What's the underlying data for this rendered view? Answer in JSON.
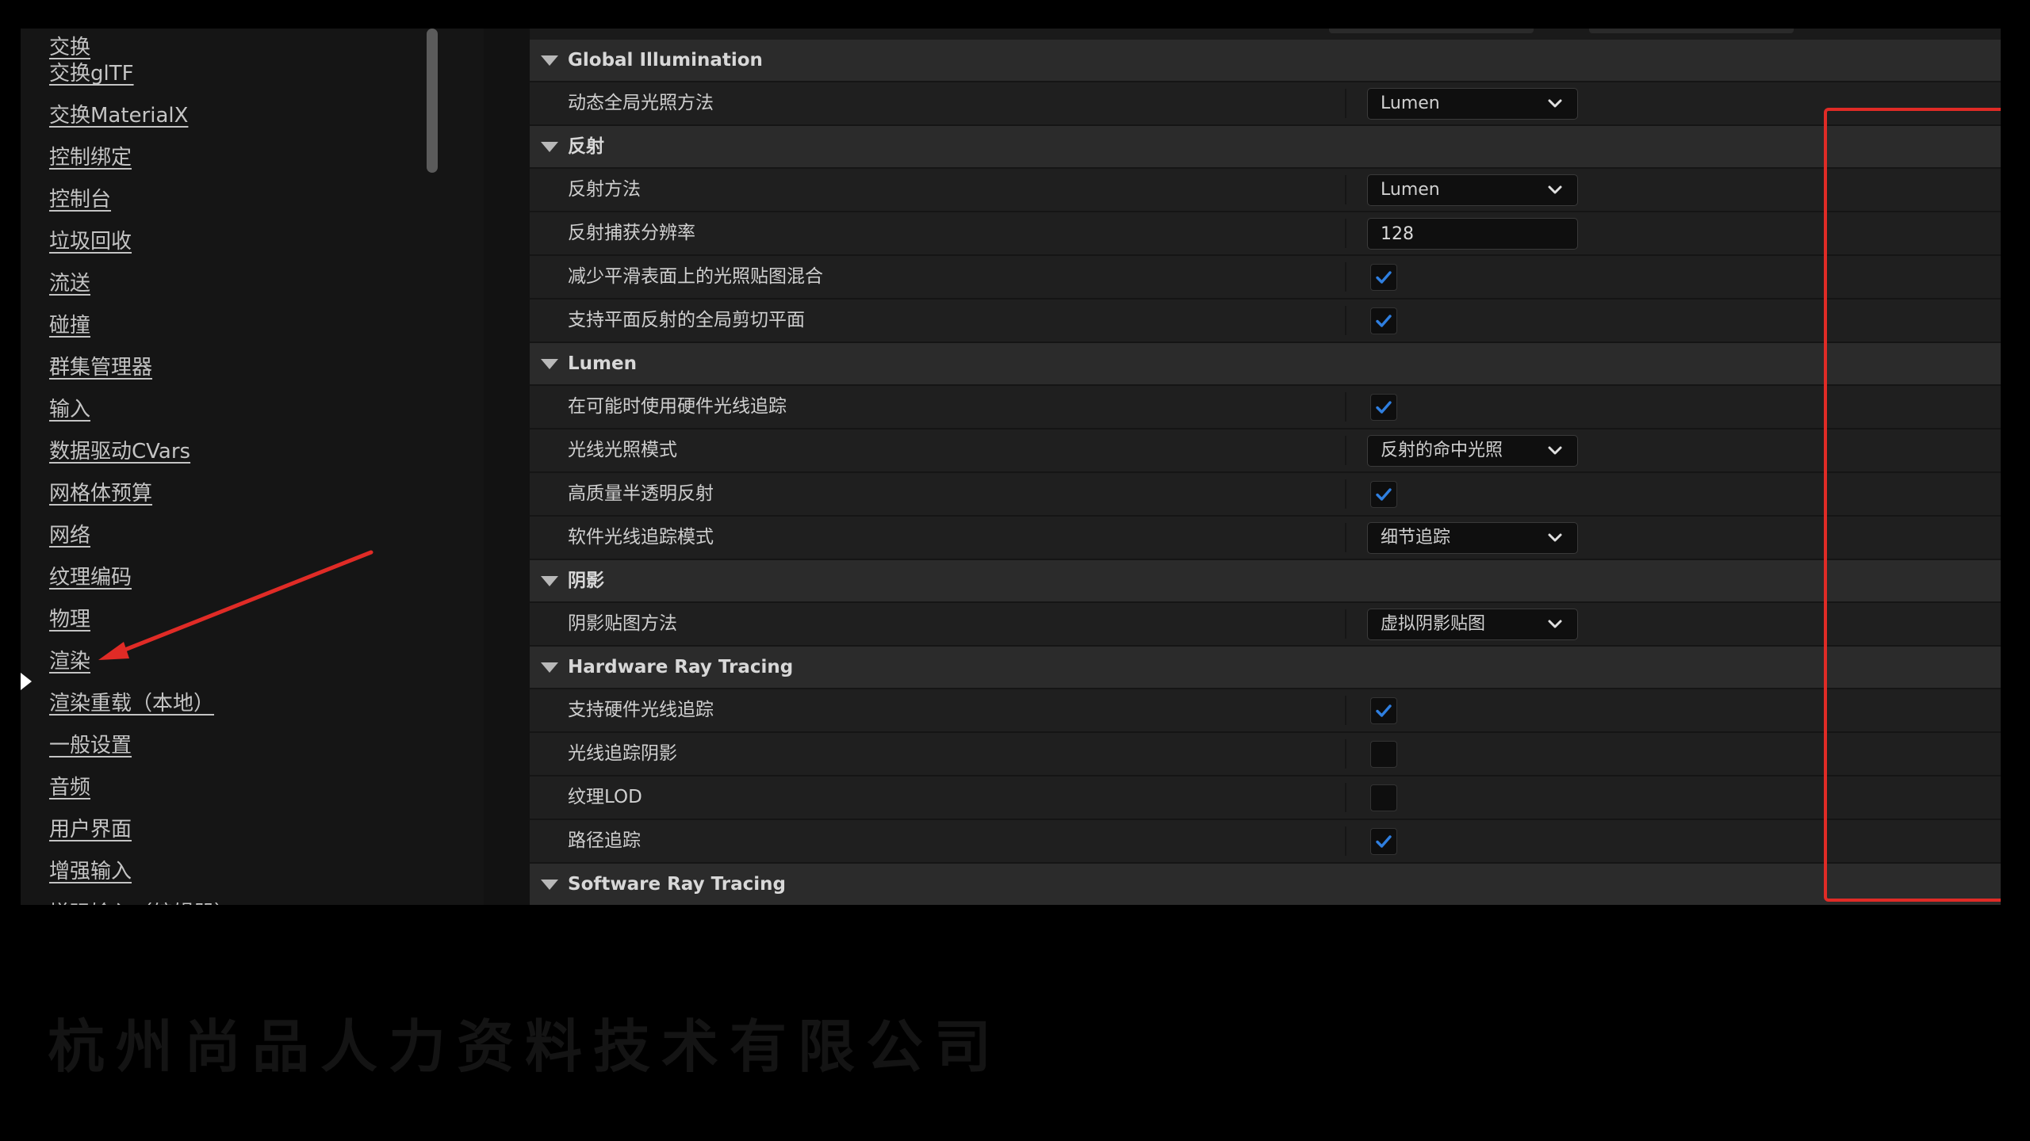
{
  "sidebar": {
    "items": [
      {
        "label": "交换"
      },
      {
        "label": "交换glTF"
      },
      {
        "label": "交换MaterialX"
      },
      {
        "label": "控制绑定"
      },
      {
        "label": "控制台"
      },
      {
        "label": "垃圾回收"
      },
      {
        "label": "流送"
      },
      {
        "label": "碰撞"
      },
      {
        "label": "群集管理器"
      },
      {
        "label": "输入"
      },
      {
        "label": "数据驱动CVars"
      },
      {
        "label": "网格体预算"
      },
      {
        "label": "网络"
      },
      {
        "label": "纹理编码"
      },
      {
        "label": "物理"
      },
      {
        "label": "渲染",
        "selected": true
      },
      {
        "label": "渲染重载（本地）"
      },
      {
        "label": "一般设置"
      },
      {
        "label": "音频"
      },
      {
        "label": "用户界面"
      },
      {
        "label": "增强输入"
      },
      {
        "label": "增强输入（编辑器）"
      }
    ]
  },
  "sections": {
    "gi": {
      "title": "Global Illumination",
      "dyn_gi_label": "动态全局光照方法",
      "dyn_gi_value": "Lumen"
    },
    "reflection": {
      "title": "反射",
      "method_label": "反射方法",
      "method_value": "Lumen",
      "capture_res_label": "反射捕获分辨率",
      "capture_res_value": "128",
      "reduce_lightmap_label": "减少平滑表面上的光照贴图混合",
      "reduce_lightmap_checked": true,
      "clip_plane_label": "支持平面反射的全局剪切平面",
      "clip_plane_checked": true
    },
    "lumen": {
      "title": "Lumen",
      "hw_rt_label": "在可能时使用硬件光线追踪",
      "hw_rt_checked": true,
      "lighting_mode_label": "光线光照模式",
      "lighting_mode_value": "反射的命中光照",
      "hq_translucency_label": "高质量半透明反射",
      "hq_translucency_checked": true,
      "sw_trace_mode_label": "软件光线追踪模式",
      "sw_trace_mode_value": "细节追踪"
    },
    "shadows": {
      "title": "阴影",
      "shadow_map_label": "阴影贴图方法",
      "shadow_map_value": "虚拟阴影贴图"
    },
    "hw_rt": {
      "title": "Hardware Ray Tracing",
      "support_label": "支持硬件光线追踪",
      "support_checked": true,
      "shadows_label": "光线追踪阴影",
      "shadows_checked": false,
      "texture_lod_label": "纹理LOD",
      "texture_lod_checked": false,
      "path_tracing_label": "路径追踪",
      "path_tracing_checked": true
    },
    "sw_rt": {
      "title": "Software Ray Tracing"
    }
  },
  "watermark": "杭州尚品人力资料技术有限公司",
  "colors": {
    "check_blue": "#2f7fe0",
    "highlight_red": "#e02b26"
  }
}
